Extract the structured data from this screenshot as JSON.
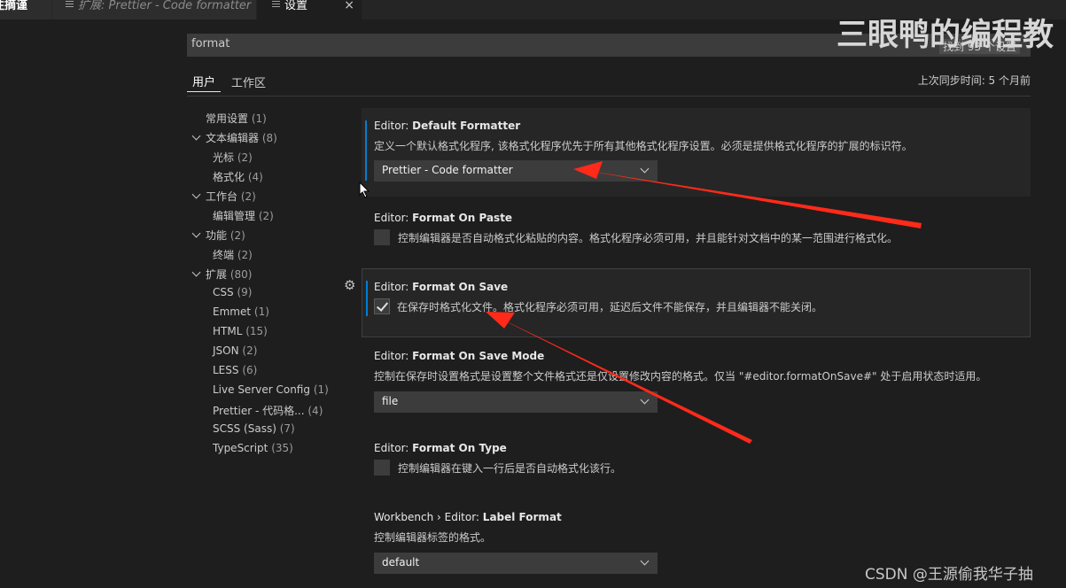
{
  "tabs": [
    {
      "label": "注摘谨"
    },
    {
      "label": "扩展: Prettier - Code formatter"
    },
    {
      "label": "设置",
      "close": "×"
    }
  ],
  "search": {
    "value": "format",
    "result_count": "找到 93 个设置"
  },
  "scope_tabs": {
    "user": "用户",
    "workspace": "工作区"
  },
  "sync_status": "上次同步时间: 5 个月前",
  "toc": [
    {
      "label": "常用设置",
      "count": "(1)"
    },
    {
      "label": "文本编辑器",
      "count": "(8)",
      "expanded": true
    },
    {
      "label": "光标",
      "count": "(2)"
    },
    {
      "label": "格式化",
      "count": "(4)"
    },
    {
      "label": "工作台",
      "count": "(2)",
      "expanded": true
    },
    {
      "label": "编辑管理",
      "count": "(2)"
    },
    {
      "label": "功能",
      "count": "(2)",
      "expanded": true
    },
    {
      "label": "终端",
      "count": "(2)"
    },
    {
      "label": "扩展",
      "count": "(80)",
      "expanded": true
    },
    {
      "label": "CSS",
      "count": "(9)"
    },
    {
      "label": "Emmet",
      "count": "(1)"
    },
    {
      "label": "HTML",
      "count": "(15)"
    },
    {
      "label": "JSON",
      "count": "(2)"
    },
    {
      "label": "LESS",
      "count": "(6)"
    },
    {
      "label": "Live Server Config",
      "count": "(1)"
    },
    {
      "label": "Prettier - 代码格...",
      "count": "(4)"
    },
    {
      "label": "SCSS (Sass)",
      "count": "(7)"
    },
    {
      "label": "TypeScript",
      "count": "(35)"
    }
  ],
  "settings": [
    {
      "category": "Editor: ",
      "name": "Default Formatter",
      "description": "定义一个默认格式化程序, 该格式化程序优先于所有其他格式化程序设置。必须是提供格式化程序的扩展的标识符。",
      "value": "Prettier - Code formatter"
    },
    {
      "category": "Editor: ",
      "name": "Format On Paste",
      "description": "控制编辑器是否自动格式化粘贴的内容。格式化程序必须可用，并且能针对文档中的某一范围进行格式化。",
      "checked": false
    },
    {
      "category": "Editor: ",
      "name": "Format On Save",
      "description": "在保存时格式化文件。格式化程序必须可用，延迟后文件不能保存，并且编辑器不能关闭。",
      "checked": true
    },
    {
      "category": "Editor: ",
      "name": "Format On Save Mode",
      "description": "控制在保存时设置格式是设置整个文件格式还是仅设置修改内容的格式。仅当 \"#editor.formatOnSave#\" 处于启用状态时适用。",
      "value": "file"
    },
    {
      "category": "Editor: ",
      "name": "Format On Type",
      "description": "控制编辑器在键入一行后是否自动格式化该行。",
      "checked": false
    },
    {
      "category": "Workbench › Editor: ",
      "name": "Label Format",
      "description": "控制编辑器标签的格式。",
      "value": "default"
    }
  ],
  "overlay": {
    "watermark": "三眼鸭的编程教",
    "credit": "CSDN @王源偷我华子抽"
  },
  "icons": [
    "preview-icon",
    "close-icon",
    "gear-icon",
    "chevron-down-icon",
    "checkmark-icon",
    "mouse-cursor-icon",
    "annotation-arrow"
  ],
  "colors": {
    "background": "#1e1e1e",
    "focus_indicator": "#007fd4",
    "annotation_arrow": "#ff2a1a"
  }
}
